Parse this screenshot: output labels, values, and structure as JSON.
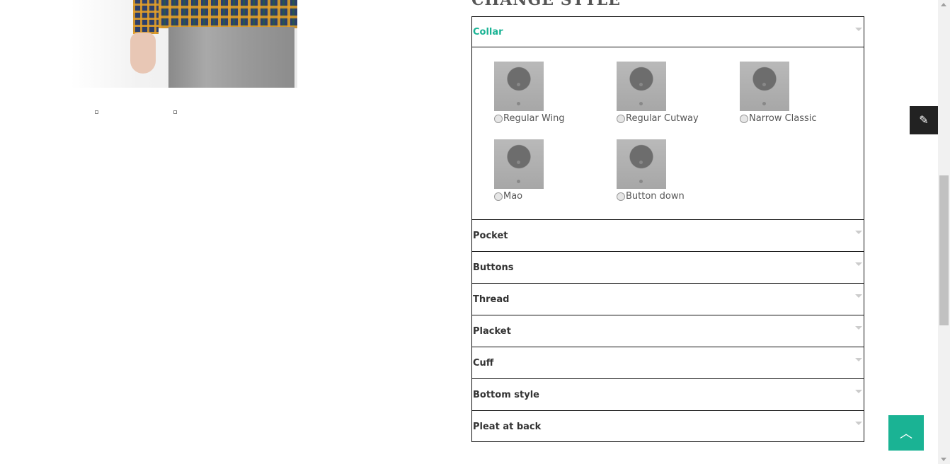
{
  "section_title": "CHANGE STYLE",
  "accent_color": "#1ab394",
  "accordion": {
    "active": {
      "label": "Collar",
      "options": [
        {
          "label": "Regular Wing",
          "icon": "collar-regular-wing-image"
        },
        {
          "label": "Regular Cutway",
          "icon": "collar-regular-cutway-image"
        },
        {
          "label": "Narrow Classic",
          "icon": "collar-narrow-classic-image"
        },
        {
          "label": "Mao",
          "icon": "collar-mao-image"
        },
        {
          "label": "Button down",
          "icon": "collar-button-down-image"
        }
      ]
    },
    "sections": [
      {
        "label": "Pocket"
      },
      {
        "label": "Buttons"
      },
      {
        "label": "Thread"
      },
      {
        "label": "Placket"
      },
      {
        "label": "Cuff"
      },
      {
        "label": "Bottom style"
      },
      {
        "label": "Pleat at back"
      }
    ]
  },
  "widgets": {
    "edit_icon": "pencil-icon",
    "scroll_top_icon": "chevron-up-icon"
  }
}
